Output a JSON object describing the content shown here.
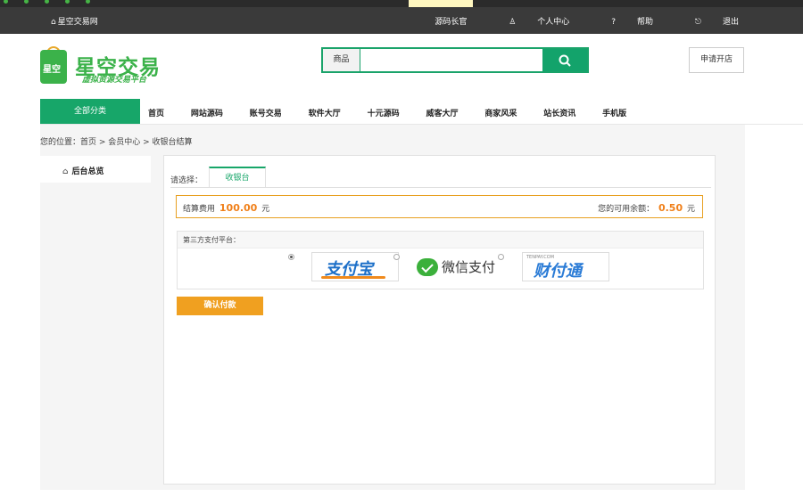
{
  "topbar": {
    "home": "星空交易网",
    "links": [
      "源码长官",
      "个人中心",
      "帮助",
      "退出"
    ]
  },
  "header": {
    "logo_title": "星空交易",
    "logo_sub": "虚拟资源交易平台",
    "logo_badge": "星空",
    "search_category": "商品",
    "search_placeholder": "",
    "apply_label": "申请开店"
  },
  "nav": {
    "category_label": "全部分类",
    "items": [
      "首页",
      "网站源码",
      "账号交易",
      "软件大厅",
      "十元源码",
      "威客大厅",
      "商家风采",
      "站长资讯",
      "手机版"
    ]
  },
  "breadcrumb": "您的位置：首页 > 会员中心 > 收银台结算",
  "sidebar": {
    "item": "后台总览"
  },
  "panel": {
    "choose_label": "请选择：",
    "tab_label": "收银台",
    "fee_label": "结算费用",
    "fee_amount": "100.00",
    "fee_unit": "元",
    "balance_label": "您的可用余额：",
    "balance_amount": "0.50",
    "balance_unit": "元",
    "pay_header": "第三方支付平台：",
    "methods": [
      {
        "name": "支付宝",
        "selected": true
      },
      {
        "name": "微信支付",
        "selected": false
      },
      {
        "name": "财付通",
        "selected": false,
        "sub": "TENPAY.COM"
      }
    ],
    "confirm_label": "确认付款"
  },
  "colors": {
    "accent": "#17a669",
    "orange": "#f0a020",
    "topbar": "#3a3a3a"
  }
}
